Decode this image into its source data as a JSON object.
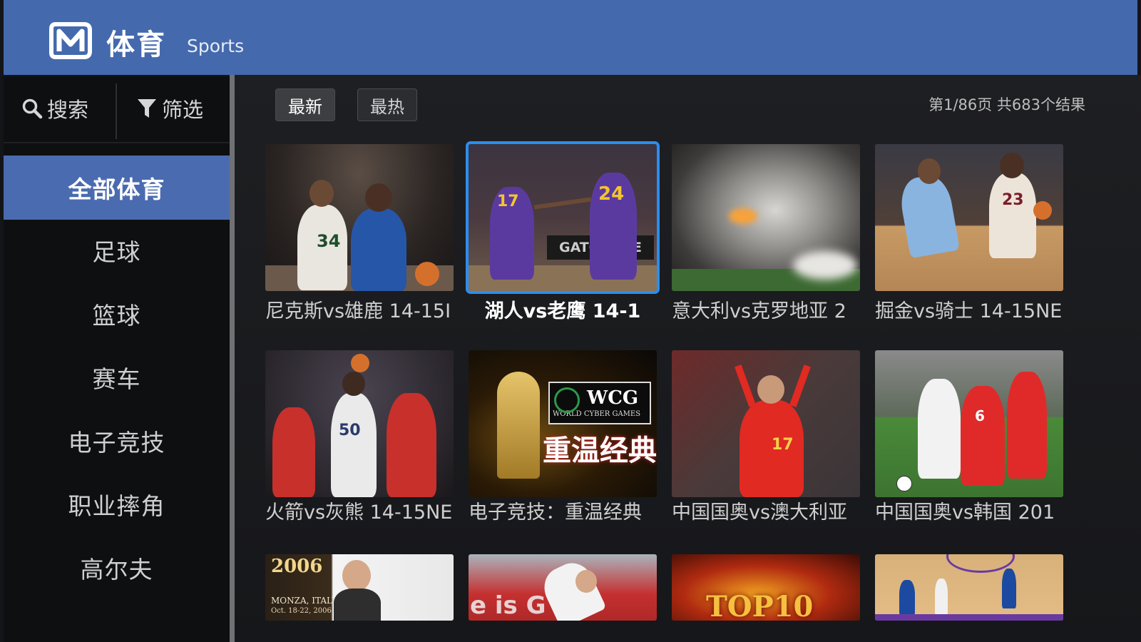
{
  "header": {
    "title": "体育",
    "subtitle": "Sports"
  },
  "sidebar": {
    "search_label": "搜索",
    "filter_label": "筛选",
    "categories": [
      {
        "label": "全部体育",
        "active": true
      },
      {
        "label": "足球"
      },
      {
        "label": "篮球"
      },
      {
        "label": "赛车"
      },
      {
        "label": "电子竞技"
      },
      {
        "label": "职业摔角"
      },
      {
        "label": "高尔夫"
      }
    ]
  },
  "sort": {
    "latest": "最新",
    "hottest": "最热",
    "active": "latest"
  },
  "page_info": "第1/86页 共683个结果",
  "grid": {
    "items": [
      {
        "caption": "尼克斯vs雄鹿 14-15I",
        "jersey": "34"
      },
      {
        "caption": "湖人vs老鹰 14-1",
        "jersey": "24",
        "jersey2": "17",
        "sign": "GATORADE",
        "focused": true
      },
      {
        "caption": "意大利vs克罗地亚 2"
      },
      {
        "caption": "掘金vs骑士 14-15NE",
        "jersey": "23"
      },
      {
        "caption": "火箭vs灰熊 14-15NE",
        "jersey": "50"
      },
      {
        "caption": "电子竞技：重温经典",
        "logo": "WCG",
        "logo_sub": "WORLD CYBER GAMES",
        "overlay": "重温经典"
      },
      {
        "caption": "中国国奥vs澳大利亚",
        "jersey": "17"
      },
      {
        "caption": "中国国奥vs韩国 201",
        "jersey": "6"
      },
      {
        "year": "2006",
        "place": "MONZA, ITALY",
        "date": "Oct. 18-22, 2006"
      },
      {
        "banner_text": "e is G"
      },
      {
        "overlay": "TOP10"
      },
      {}
    ]
  },
  "colors": {
    "header": "#4469ad",
    "active_category": "#4a6bb0",
    "focus_border": "#2a8ef0"
  }
}
